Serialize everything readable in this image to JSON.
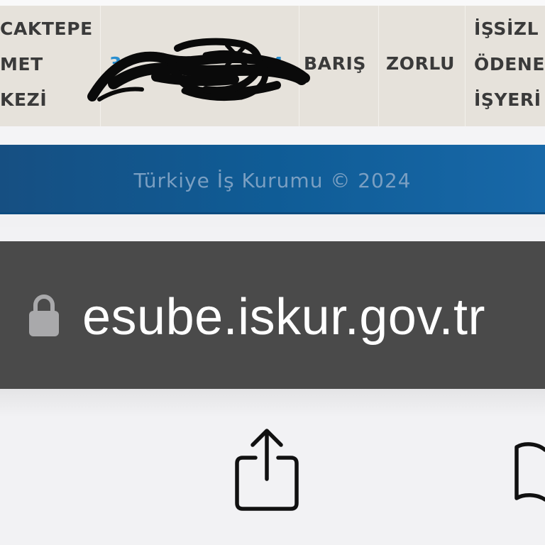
{
  "table_row": {
    "cell1_lines": [
      "CAKTEPE",
      "MET",
      "KEZİ"
    ],
    "cell2_phone": "3",
    "cell2_phone_tail": "4",
    "cell3_first_name": "BARIŞ",
    "cell4_last_name": "ZORLU",
    "cell5_lines": [
      "İŞSİZL",
      "ÖDENE",
      "İŞYERİ"
    ]
  },
  "footer": {
    "copyright": "Türkiye İş Kurumu © 2024"
  },
  "address_bar": {
    "url": "esube.iskur.gov.tr",
    "icon": "lock-icon"
  },
  "toolbar": {
    "icons": [
      "share-icon",
      "bookmarks-icon"
    ]
  },
  "colors": {
    "footer_blue": "#0f5c96",
    "phone_link": "#2a8fd0",
    "address_bar_bg": "#4a4a4a"
  }
}
